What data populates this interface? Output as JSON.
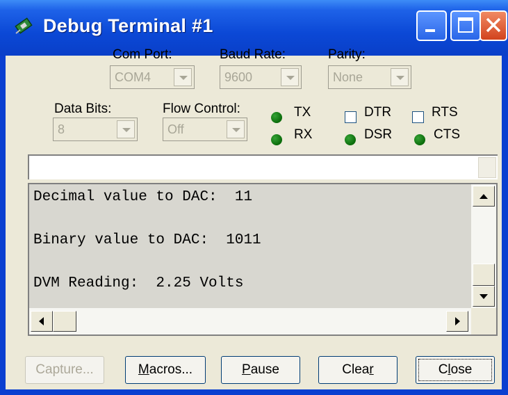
{
  "window": {
    "title": "Debug Terminal #1"
  },
  "settings": {
    "com_port": {
      "label": "Com Port:",
      "value": "COM4"
    },
    "baud_rate": {
      "label": "Baud Rate:",
      "value": "9600"
    },
    "parity": {
      "label": "Parity:",
      "value": "None"
    },
    "data_bits": {
      "label": "Data Bits:",
      "value": "8"
    },
    "flow_control": {
      "label": "Flow Control:",
      "value": "Off"
    }
  },
  "indicators": {
    "tx": "TX",
    "rx": "RX",
    "dsr": "DSR",
    "cts": "CTS",
    "led_color": "#0a6b0a"
  },
  "checkboxes": {
    "dtr": {
      "label": "DTR",
      "checked": false
    },
    "rts": {
      "label": "RTS",
      "checked": false
    }
  },
  "transmit_field": {
    "value": ""
  },
  "output": {
    "lines": [
      "Decimal value to DAC:  11",
      "",
      "Binary value to DAC:  1011",
      "",
      "DVM Reading:  2.25 Volts"
    ]
  },
  "buttons": {
    "capture": {
      "pre": "Capture...",
      "u": "",
      "post": ""
    },
    "macros": {
      "pre": "",
      "u": "M",
      "post": "acros..."
    },
    "pause": {
      "pre": "",
      "u": "P",
      "post": "ause"
    },
    "clear": {
      "pre": "Clea",
      "u": "r",
      "post": ""
    },
    "close": {
      "pre": "C",
      "u": "l",
      "post": "ose"
    }
  }
}
